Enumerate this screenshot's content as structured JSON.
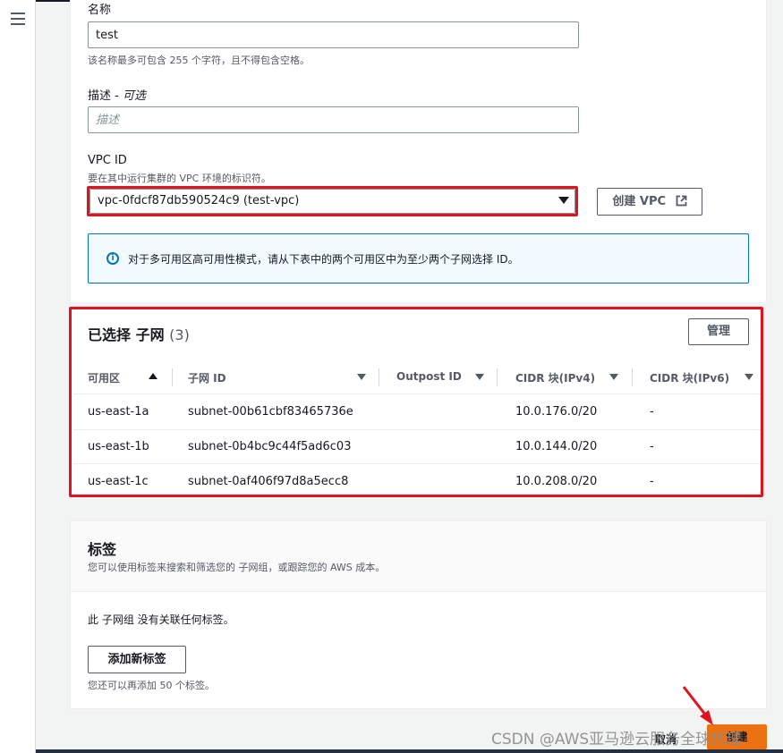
{
  "nav": {
    "menu_icon": "hamburger-icon"
  },
  "form": {
    "name_label": "名称",
    "name_value": "test",
    "name_hint": "该名称最多可包含 255 个字符，且不得包含空格。",
    "desc_label": "描述 - ",
    "desc_optional": "可选",
    "desc_placeholder": "描述",
    "vpc_label": "VPC ID",
    "vpc_hint": "要在其中运行集群的 VPC 环境的标识符。",
    "vpc_value": "vpc-0fdcf87db590524c9 (test-vpc)",
    "create_vpc_label": "创建 VPC",
    "info_text": "对于多可用区高可用性模式，请从下表中的两个可用区中为至少两个子网选择 ID。"
  },
  "subnets": {
    "title": "已选择 子网",
    "count": "(3)",
    "manage_label": "管理",
    "columns": [
      "可用区",
      "子网 ID",
      "Outpost ID",
      "CIDR 块(IPv4)",
      "CIDR 块(IPv6)"
    ],
    "rows": [
      [
        "us-east-1a",
        "subnet-00b61cbf83465736e",
        "",
        "10.0.176.0/20",
        "-"
      ],
      [
        "us-east-1b",
        "subnet-0b4bc9c44f5ad6c03",
        "",
        "10.0.144.0/20",
        "-"
      ],
      [
        "us-east-1c",
        "subnet-0af406f97d8a5ecc8",
        "",
        "10.0.208.0/20",
        "-"
      ]
    ]
  },
  "tags": {
    "title": "标签",
    "subtitle": "您可以使用标签来搜索和筛选您的 子网组，或跟踪您的 AWS 成本。",
    "empty_text": "此 子网组 没有关联任何标签。",
    "add_label": "添加新标签",
    "limit_text": "您还可以再添加 50 个标签。"
  },
  "footer": {
    "cancel_label": "取消",
    "create_label": "创建"
  },
  "watermark": "CSDN @AWS亚马逊云服务全球代理",
  "colors": {
    "accent": "#ec7211",
    "highlight": "#e0131f",
    "info": "#0073bb"
  }
}
